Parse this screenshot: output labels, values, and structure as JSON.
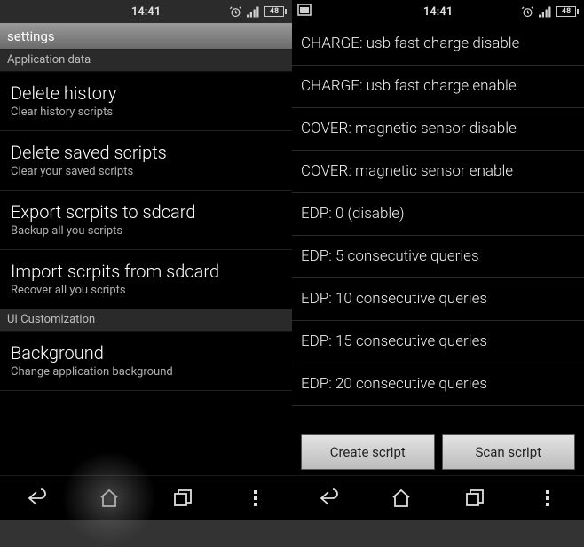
{
  "status": {
    "time": "14:41",
    "battery": "48"
  },
  "left": {
    "settings_header": "settings",
    "section1": "Application data",
    "items": [
      {
        "title": "Delete history",
        "sub": "Clear history scripts"
      },
      {
        "title": "Delete saved scripts",
        "sub": "Clear your saved scripts"
      },
      {
        "title": "Export scrpits to sdcard",
        "sub": "Backup all you scripts"
      },
      {
        "title": "Import scrpits from sdcard",
        "sub": "Recover all you scripts"
      }
    ],
    "section2": "UI Customization",
    "items2": [
      {
        "title": "Background",
        "sub": "Change application background"
      }
    ]
  },
  "right": {
    "scripts": [
      "CHARGE: usb fast charge disable",
      "CHARGE: usb fast charge enable",
      "COVER: magnetic sensor disable",
      "COVER: magnetic sensor enable",
      "EDP:  0 (disable)",
      "EDP:  5 consecutive queries",
      "EDP: 10 consecutive queries",
      "EDP: 15 consecutive queries",
      "EDP: 20 consecutive queries"
    ],
    "buttons": {
      "create": "Create script",
      "scan": "Scan script"
    }
  }
}
